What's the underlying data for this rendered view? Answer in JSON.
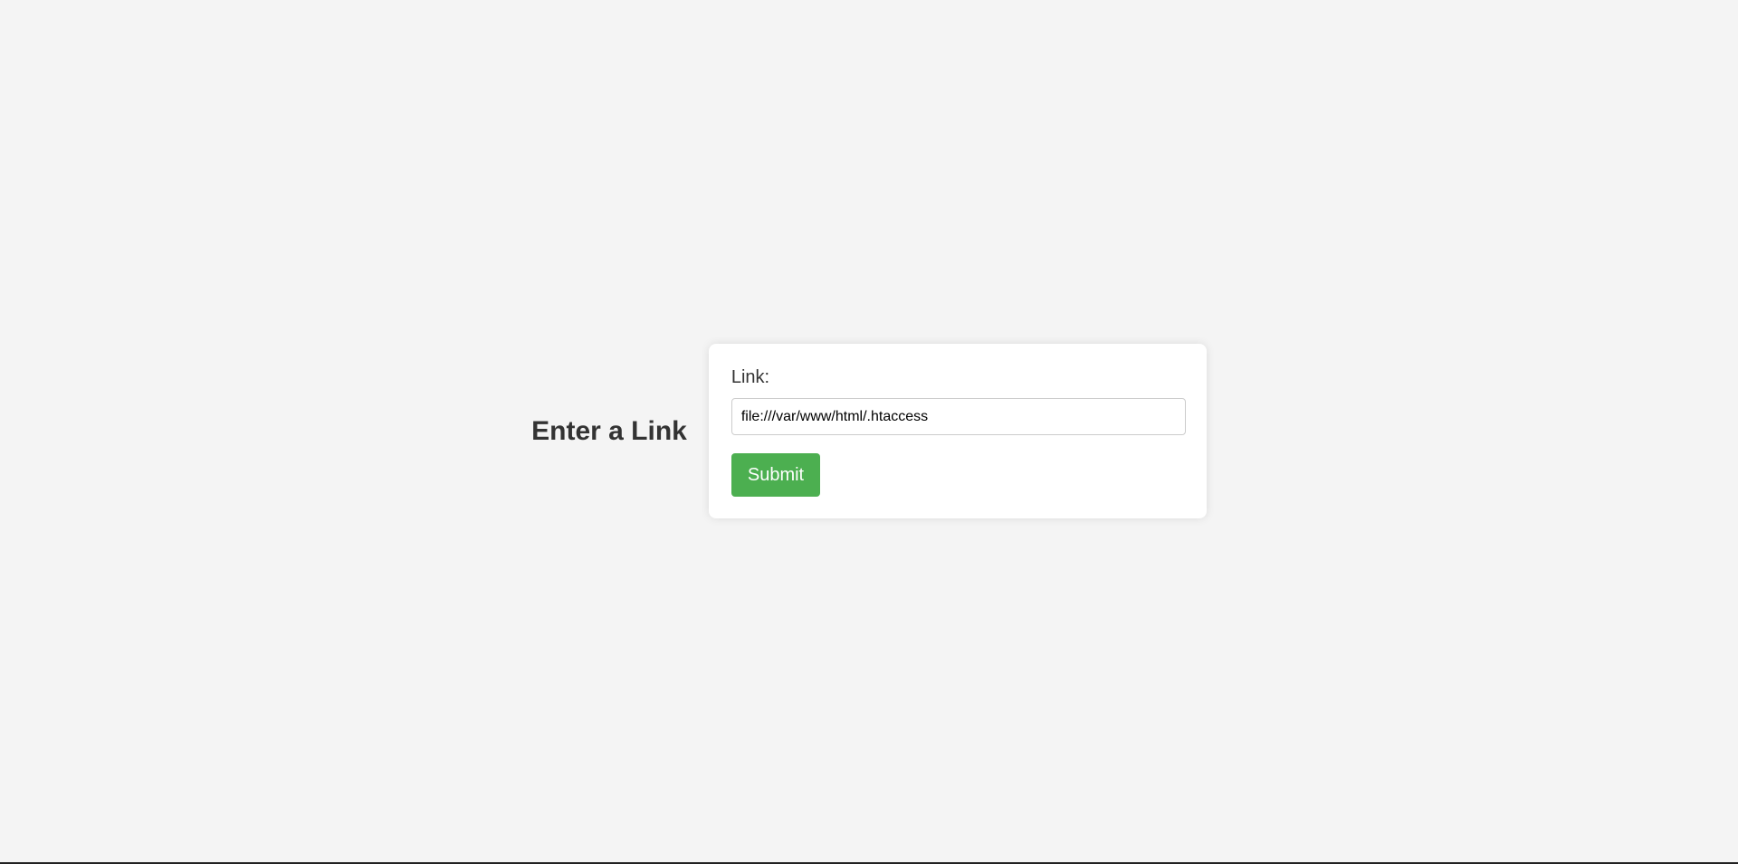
{
  "page": {
    "title": "Enter a Link"
  },
  "form": {
    "link_label": "Link:",
    "link_value": "file:///var/www/html/.htaccess",
    "submit_label": "Submit"
  },
  "colors": {
    "background": "#f4f4f4",
    "card": "#ffffff",
    "submit_button": "#4caf50",
    "text": "#333333"
  }
}
